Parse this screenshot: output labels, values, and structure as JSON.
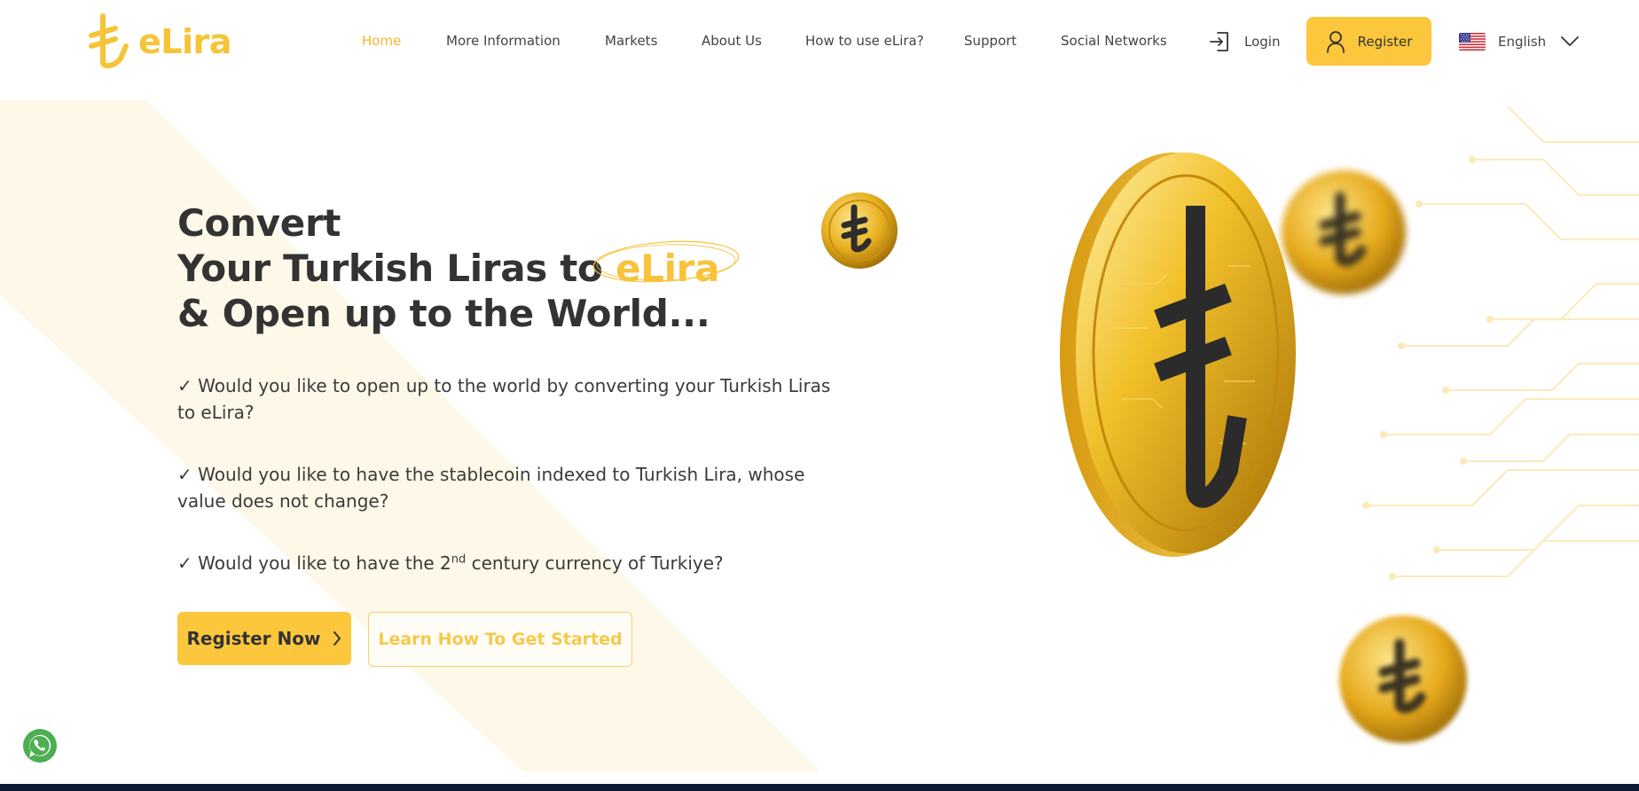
{
  "brand": {
    "name": "eLira",
    "color": "#f5c437"
  },
  "nav": {
    "items": [
      {
        "label": "Home",
        "active": true
      },
      {
        "label": "More Information",
        "active": false
      },
      {
        "label": "Markets",
        "active": false
      },
      {
        "label": "About Us",
        "active": false
      },
      {
        "label": "How to use eLira?",
        "active": false
      },
      {
        "label": "Support",
        "active": false
      },
      {
        "label": "Social Networks",
        "active": false
      }
    ],
    "login_label": "Login",
    "register_label": "Register",
    "language": "English"
  },
  "hero": {
    "title_line1": "Convert",
    "title_line2_prefix": "Your Turkish Liras to ",
    "title_line2_highlight": "eLira",
    "title_line3": "& Open up to the World...",
    "bullets": [
      "✓ Would you like to open up to the world by converting your Turkish Liras to eLira?",
      "✓ Would you like to have the stablecoin indexed to Turkish Lira, whose value does not change?"
    ],
    "bullet3_prefix": "✓ Would you like to have the 2",
    "bullet3_sup": "nd",
    "bullet3_suffix": " century currency of Turkiye?",
    "cta_primary": "Register Now",
    "cta_secondary": "Learn How To Get Started"
  },
  "colors": {
    "accent": "#fcc73c",
    "text": "#333333",
    "active_nav": "#f5b82e",
    "footer_bar": "#0e1a36",
    "whatsapp": "#4caf50"
  },
  "icons": [
    "login-icon",
    "user-icon",
    "us-flag-icon",
    "chevron-down-icon",
    "chevron-right-icon",
    "whatsapp-icon",
    "lira-coin-icon"
  ]
}
